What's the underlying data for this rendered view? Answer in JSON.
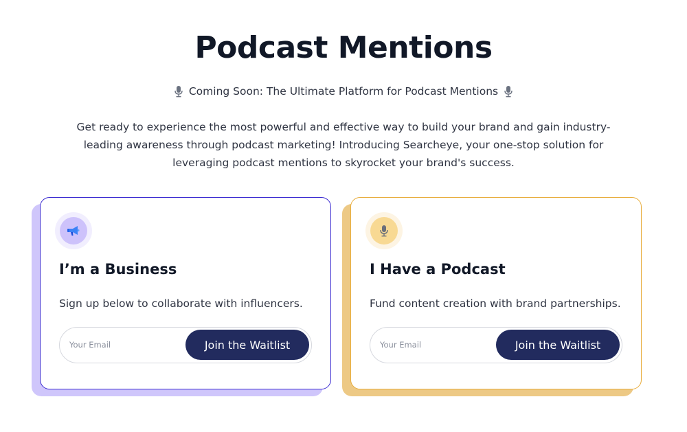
{
  "header": {
    "title": "Podcast Mentions",
    "subtitle": "Coming Soon: The Ultimate Platform for Podcast Mentions",
    "description": "Get ready to experience the most powerful and effective way to build your brand and gain industry-leading awareness through podcast marketing! Introducing Searcheye, your one-stop solution for leveraging podcast mentions to skyrocket your brand's success."
  },
  "cards": {
    "business": {
      "icon": "megaphone-icon",
      "title": "I’m a Business",
      "text": "Sign up below to collaborate with influencers.",
      "email_placeholder": "Your Email",
      "button_label": "Join the Waitlist",
      "accent": "#3b2bd1",
      "shadow": "#cfc6fb"
    },
    "podcast": {
      "icon": "microphone-icon",
      "title": "I Have a Podcast",
      "text": "Fund content creation with brand partnerships.",
      "email_placeholder": "Your Email",
      "button_label": "Join the Waitlist",
      "accent": "#e8ad3d",
      "shadow": "#edc985"
    }
  },
  "colors": {
    "button": "#222b5e",
    "heading": "#111827"
  }
}
